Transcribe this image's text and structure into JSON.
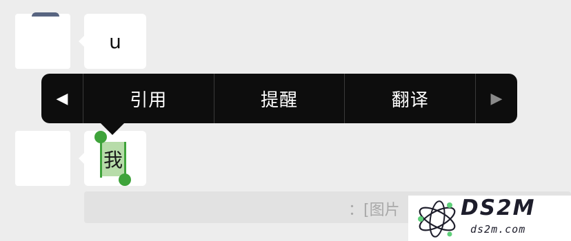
{
  "messages": [
    {
      "text": "u"
    },
    {
      "text": "我"
    }
  ],
  "context_menu": {
    "prev_glyph": "◀",
    "items": [
      "引用",
      "提醒",
      "翻译"
    ],
    "next_glyph": "▶"
  },
  "system_message": {
    "text": "：[图片"
  },
  "watermark": {
    "primary": "DS2M",
    "secondary": "ds2m.com"
  },
  "colors": {
    "background": "#ededed",
    "menu": "#0d0d0d",
    "selection_highlight": "#b7dca9",
    "selection_handle": "#3ea33a"
  }
}
